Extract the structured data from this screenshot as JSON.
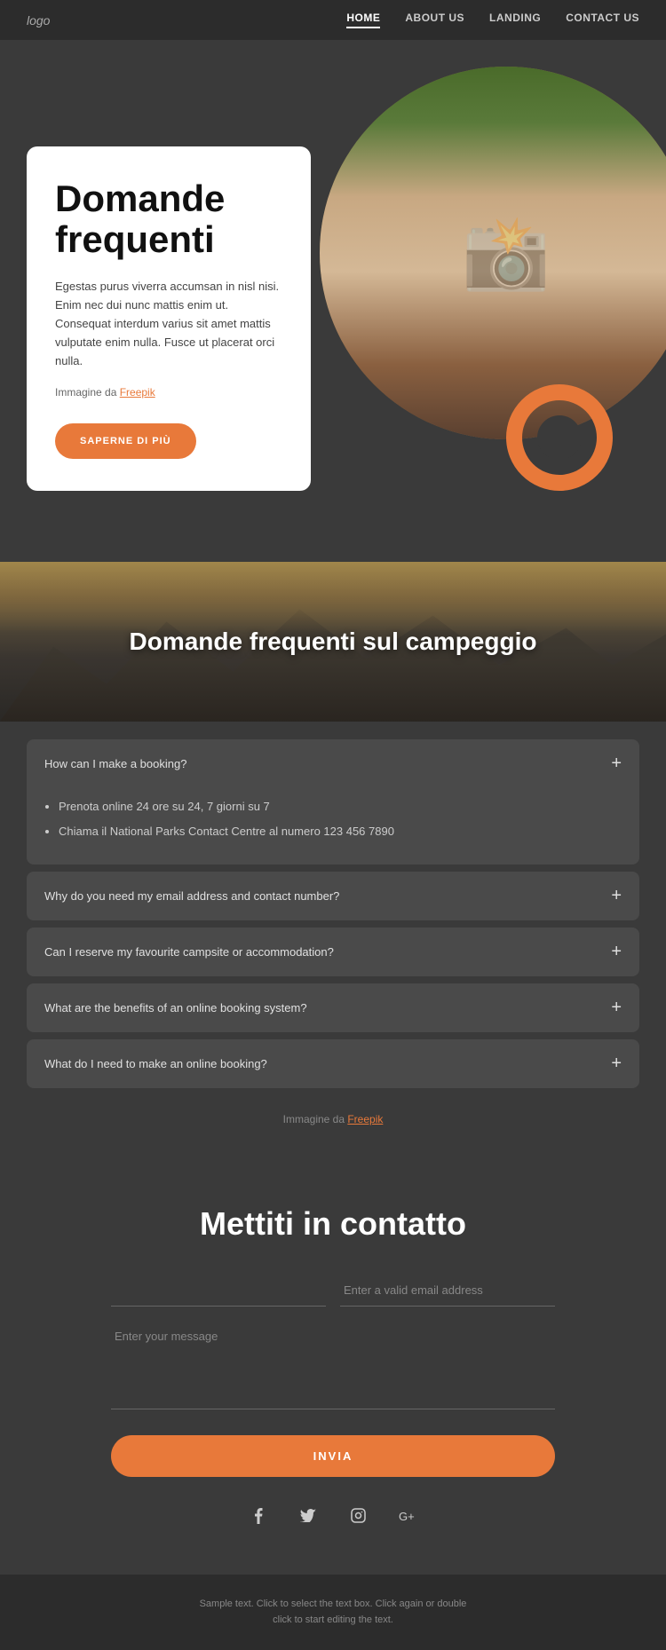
{
  "navbar": {
    "logo": "logo",
    "links": [
      {
        "label": "HOME",
        "active": true
      },
      {
        "label": "ABOUT US",
        "active": false
      },
      {
        "label": "LANDING",
        "active": false
      },
      {
        "label": "CONTACT US",
        "active": false
      }
    ]
  },
  "hero": {
    "title_line1": "Domande",
    "title_line2": "frequenti",
    "description": "Egestas purus viverra accumsan in nisl nisi. Enim nec dui nunc mattis enim ut. Consequat interdum varius sit amet mattis vulputate enim nulla. Fusce ut placerat orci nulla.",
    "image_attr_prefix": "Immagine da ",
    "image_attr_link": "Freepik",
    "cta_label": "SAPERNE DI PIÙ"
  },
  "faq_banner": {
    "title": "Domande frequenti sul campeggio"
  },
  "faq_items": [
    {
      "question": "How can I make a booking?",
      "expanded": true,
      "answers": [
        "Prenota online 24 ore su 24, 7 giorni su 7",
        "Chiama il National Parks Contact Centre al numero 123 456 7890"
      ]
    },
    {
      "question": "Why do you need my email address and contact number?",
      "expanded": false,
      "answers": []
    },
    {
      "question": "Can I reserve my favourite campsite or accommodation?",
      "expanded": false,
      "answers": []
    },
    {
      "question": "What are the benefits of an online booking system?",
      "expanded": false,
      "answers": []
    },
    {
      "question": "What do I need to make an online booking?",
      "expanded": false,
      "answers": []
    }
  ],
  "faq_attr_prefix": "Immagine da ",
  "faq_attr_link": "Freepik",
  "contact": {
    "title": "Mettiti in contatto",
    "name_placeholder": "",
    "email_placeholder": "Enter a valid email address",
    "message_placeholder": "Enter your message",
    "submit_label": "INVIA"
  },
  "social": {
    "icons": [
      "f",
      "t",
      "inst",
      "g+"
    ]
  },
  "footer": {
    "text_line1": "Sample text. Click to select the text box. Click again or double",
    "text_line2": "click to start editing the text."
  }
}
